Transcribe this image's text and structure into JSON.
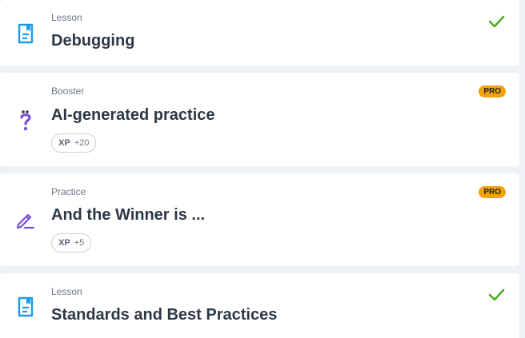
{
  "items": [
    {
      "type": "Lesson",
      "title": "Debugging",
      "icon": "lesson-document-icon",
      "status": "completed"
    },
    {
      "type": "Booster",
      "title": "AI-generated practice",
      "icon": "booster-question-icon",
      "badge": "PRO",
      "xp_label": "XP",
      "xp_value": "+20"
    },
    {
      "type": "Practice",
      "title": "And the Winner is ...",
      "icon": "practice-pencil-icon",
      "badge": "PRO",
      "xp_label": "XP",
      "xp_value": "+5"
    },
    {
      "type": "Lesson",
      "title": "Standards and Best Practices",
      "icon": "lesson-document-icon",
      "status": "completed"
    }
  ],
  "colors": {
    "lesson_icon": "#1e9be6",
    "booster_icon": "#7b4fd6",
    "practice_icon": "#7b4fd6",
    "check": "#4caf1e",
    "pro_badge": "#f5a10a"
  }
}
